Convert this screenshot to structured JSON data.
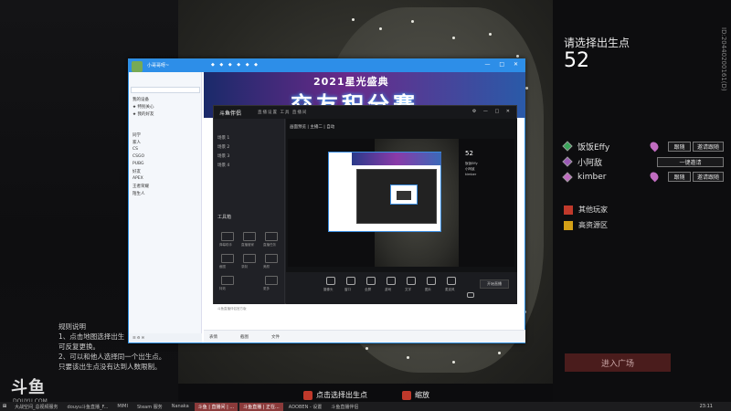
{
  "game": {
    "spawn_title": "请选择出生点",
    "countdown": "52",
    "side_id": "ID:20440200161(D)",
    "team": [
      {
        "name": "饭饭Effy",
        "color": "#3aa55a",
        "actions": [
          "跟随",
          "邀请跟随"
        ]
      },
      {
        "name": "小阿敌",
        "color": "#9b59b6",
        "actions": [
          "一键邀请"
        ]
      },
      {
        "name": "kimber",
        "color": "#c06cc0",
        "actions": [
          "跟随",
          "邀请跟随"
        ]
      }
    ],
    "legend": [
      {
        "label": "其他玩家",
        "color": "#c0392b"
      },
      {
        "label": "高资源区",
        "color": "#d4a017"
      }
    ],
    "enter_button": "进入广场",
    "rules_title": "规则说明",
    "rules_lines": [
      "1、点击地图选择出生",
      "可反复更换。",
      "2、可以和他人选择同一个出生点。",
      "只要该出生点没有达到人数限制。"
    ],
    "hints": [
      {
        "label": "点击选择出生点"
      },
      {
        "label": "缩放"
      }
    ]
  },
  "logo": {
    "mark": "斗鱼",
    "sub": "DOUYU.COM"
  },
  "qq": {
    "user_name": "小哥哥呀~",
    "list": [
      "我的设备",
      "★ 特别关心",
      "★ 我的好友",
      "同学",
      "家人",
      "CS",
      "CSGO",
      "PUBG",
      "好友",
      "APEX",
      "王者荣耀",
      "陌生人"
    ],
    "banner_top": "2021星光盛典",
    "banner_main": "交友积分赛",
    "footer_items": [
      "表情",
      "截图",
      "文件"
    ]
  },
  "tool": {
    "logo": "斗鱼伴侣",
    "tabs": [
      "直播设置",
      "工具",
      "直播间"
    ],
    "preview_title": "画面预览 | 主播二 | 自动",
    "scenes": [
      "场景 1",
      "场景 2",
      "场景 3",
      "场景 4"
    ],
    "tools_label": "工具箱",
    "tiles": [
      "弹幕助手",
      "直播管家",
      "直播任务",
      "截图",
      "录制",
      "美颜",
      "特效",
      "更多"
    ],
    "bottom": [
      "摄像头",
      "窗口",
      "全屏",
      "游戏",
      "文字",
      "图片",
      "麦克风",
      "音量"
    ],
    "live_button": "开始直播",
    "preview_num": "52",
    "footer": "斗鱼直播伴侣官方版"
  },
  "taskbar": {
    "items": [
      "大战空间_总视频服务",
      "douyu斗鱼直播_F...",
      "MIMI",
      "Steam 服务",
      "Nanaka",
      "斗鱼 | 直播间 | ...",
      "斗鱼直播 | 正在...",
      "ADOBEN - 设置",
      "斗鱼直播伴侣"
    ],
    "clock": "23:11"
  }
}
